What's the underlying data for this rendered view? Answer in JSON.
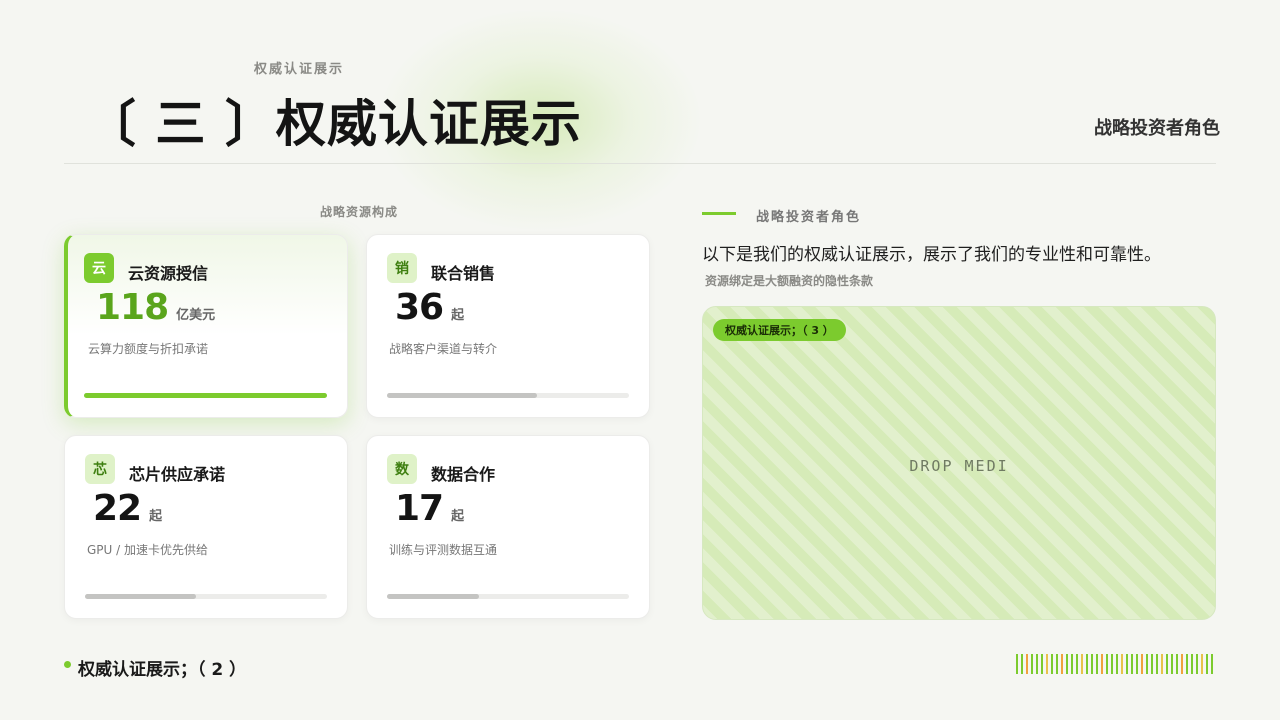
{
  "header": {
    "kicker": "权威认证展示",
    "title": "〔 三 〕权威认证展示",
    "right_label": "战略投资者角色"
  },
  "grid": {
    "label": "战略资源构成",
    "cards": [
      {
        "badge": "云",
        "title": "云资源授信",
        "value": "118",
        "unit": "亿美元",
        "desc": "云算力额度与折扣承诺",
        "progress": 1.0,
        "active": true
      },
      {
        "badge": "销",
        "title": "联合销售",
        "value": "36",
        "unit": "起",
        "desc": "战略客户渠道与转介",
        "progress": 0.62,
        "active": false
      },
      {
        "badge": "芯",
        "title": "芯片供应承诺",
        "value": "22",
        "unit": "起",
        "desc": "GPU /  加速卡优先供给",
        "progress": 0.46,
        "active": false
      },
      {
        "badge": "数",
        "title": "数据合作",
        "value": "17",
        "unit": "起",
        "desc": "训练与评测数据互通",
        "progress": 0.38,
        "active": false
      }
    ]
  },
  "side": {
    "label": "战略投资者角色",
    "description": "以下是我们的权威认证展示，展示了我们的专业性和可靠性。",
    "note": "资源绑定是大额融资的隐性条款",
    "media_tag": "权威认证展示；（ 3 ）",
    "media_text": "DROP MEDI"
  },
  "footer": {
    "text": "权威认证展示；（ 2 ）"
  },
  "colors": {
    "accent": "#7ccb2e",
    "accent_dark": "#5aa51c",
    "barcode": [
      "#7ccb2e",
      "#7ccb2e",
      "#f0a23c",
      "#7ccb2e",
      "#7ccb2e",
      "#7ccb2e",
      "#e8c24a",
      "#7ccb2e",
      "#7ccb2e",
      "#f0a23c",
      "#7ccb2e",
      "#7ccb2e",
      "#7ccb2e",
      "#e8c24a",
      "#7ccb2e",
      "#7ccb2e",
      "#7ccb2e",
      "#f0a23c",
      "#7ccb2e",
      "#7ccb2e",
      "#7ccb2e",
      "#e8c24a",
      "#7ccb2e",
      "#7ccb2e",
      "#7ccb2e",
      "#f0a23c",
      "#7ccb2e",
      "#7ccb2e",
      "#7ccb2e",
      "#e8c24a",
      "#7ccb2e",
      "#7ccb2e",
      "#7ccb2e",
      "#f0a23c",
      "#7ccb2e",
      "#7ccb2e",
      "#7ccb2e",
      "#e8c24a",
      "#7ccb2e",
      "#7ccb2e"
    ]
  }
}
